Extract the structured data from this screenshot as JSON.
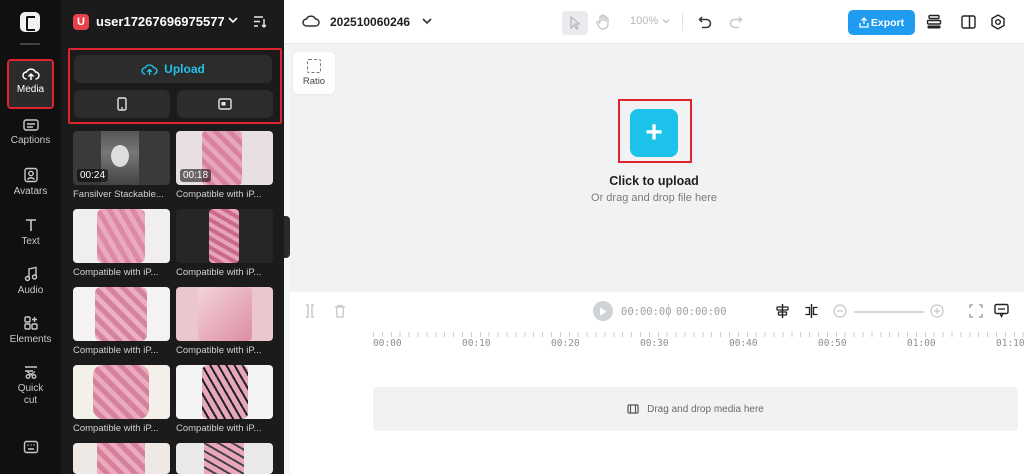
{
  "rail": {
    "items": [
      {
        "label": "Media",
        "icon": "cloud-upload-icon",
        "active": true
      },
      {
        "label": "Captions",
        "icon": "captions-icon"
      },
      {
        "label": "Avatars",
        "icon": "avatar-icon"
      },
      {
        "label": "Text",
        "icon": "text-icon"
      },
      {
        "label": "Audio",
        "icon": "music-icon"
      },
      {
        "label": "Elements",
        "icon": "elements-icon"
      },
      {
        "label": "Quick\ncut",
        "icon": "quick-cut-icon"
      }
    ],
    "bottom_icon": "keyboard-icon"
  },
  "panel": {
    "avatar_letter": "U",
    "user_name": "user17267696975577",
    "upload_label": "Upload",
    "tiles": [
      {
        "caption": "Fansilver Stackable...",
        "duration": "00:24"
      },
      {
        "caption": "Compatible with iP...",
        "duration": "00:18"
      },
      {
        "caption": "Compatible with iP...",
        "duration": ""
      },
      {
        "caption": "Compatible with iP...",
        "duration": ""
      },
      {
        "caption": "Compatible with iP...",
        "duration": ""
      },
      {
        "caption": "Compatible with iP...",
        "duration": ""
      },
      {
        "caption": "Compatible with iP...",
        "duration": ""
      },
      {
        "caption": "Compatible with iP...",
        "duration": ""
      },
      {
        "caption": "",
        "duration": ""
      },
      {
        "caption": "",
        "duration": ""
      }
    ]
  },
  "topbar": {
    "project_name": "202510060246",
    "zoom": "100%",
    "export_label": "Export"
  },
  "canvas": {
    "ratio_label": "Ratio",
    "upload_title": "Click to upload",
    "upload_subtitle": "Or drag and drop file here"
  },
  "timeline": {
    "current_time": "00:00:00",
    "total_time": "00:00:00",
    "ticks": [
      "00:00",
      "00:10",
      "00:20",
      "00:30",
      "00:40",
      "00:50",
      "01:00",
      "01:10"
    ],
    "drop_label": "Drag and drop media here"
  },
  "colors": {
    "accent": "#1cc2ea",
    "export": "#1f9bf0",
    "highlight": "#e0232f",
    "panel_bg": "#1b1b1b",
    "rail_bg": "#101010"
  }
}
